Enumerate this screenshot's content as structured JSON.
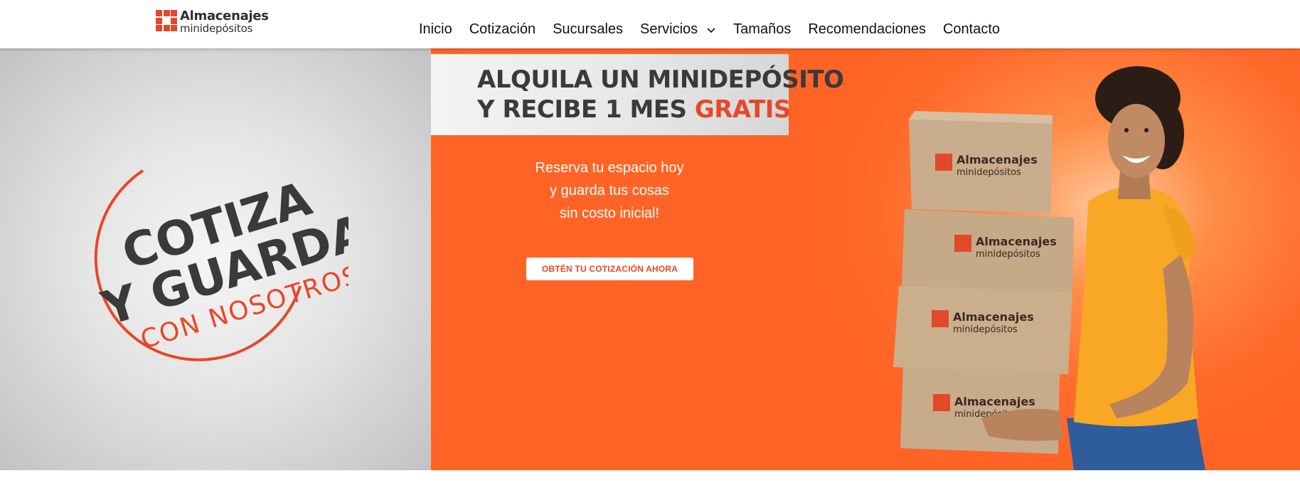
{
  "brand": {
    "name": "Almacenajes",
    "tagline": "minidepósitos",
    "logo_color": "#e2482a"
  },
  "nav": {
    "items": [
      {
        "label": "Inicio"
      },
      {
        "label": "Cotización"
      },
      {
        "label": "Sucursales"
      },
      {
        "label": "Servicios",
        "icon": "chevron-down-icon"
      },
      {
        "label": "Tamaños"
      },
      {
        "label": "Recomendaciones"
      },
      {
        "label": "Contacto"
      }
    ]
  },
  "hero": {
    "badge": {
      "line1": "COTIZA",
      "line2": "Y GUARDA",
      "line3": "CON NOSOTROS"
    },
    "promo": {
      "line1": "ALQUILA UN MINIDEPÓSITO",
      "line2_prefix": "Y RECIBE 1 MES ",
      "line2_accent": "GRATIS"
    },
    "copy": {
      "line1": "Reserva tu espacio hoy",
      "line2": "y guarda tus cosas",
      "line3": "sin costo inicial!"
    },
    "cta_label": "OBTÉN TU COTIZACIÓN AHORA",
    "box_brand": "Almacenajes",
    "box_sub": "minidepósitos"
  },
  "colors": {
    "accent": "#e8472a",
    "hero_orange": "#ff6a2b",
    "text_dark": "#3a3a3a",
    "shirt": "#f8a824"
  }
}
